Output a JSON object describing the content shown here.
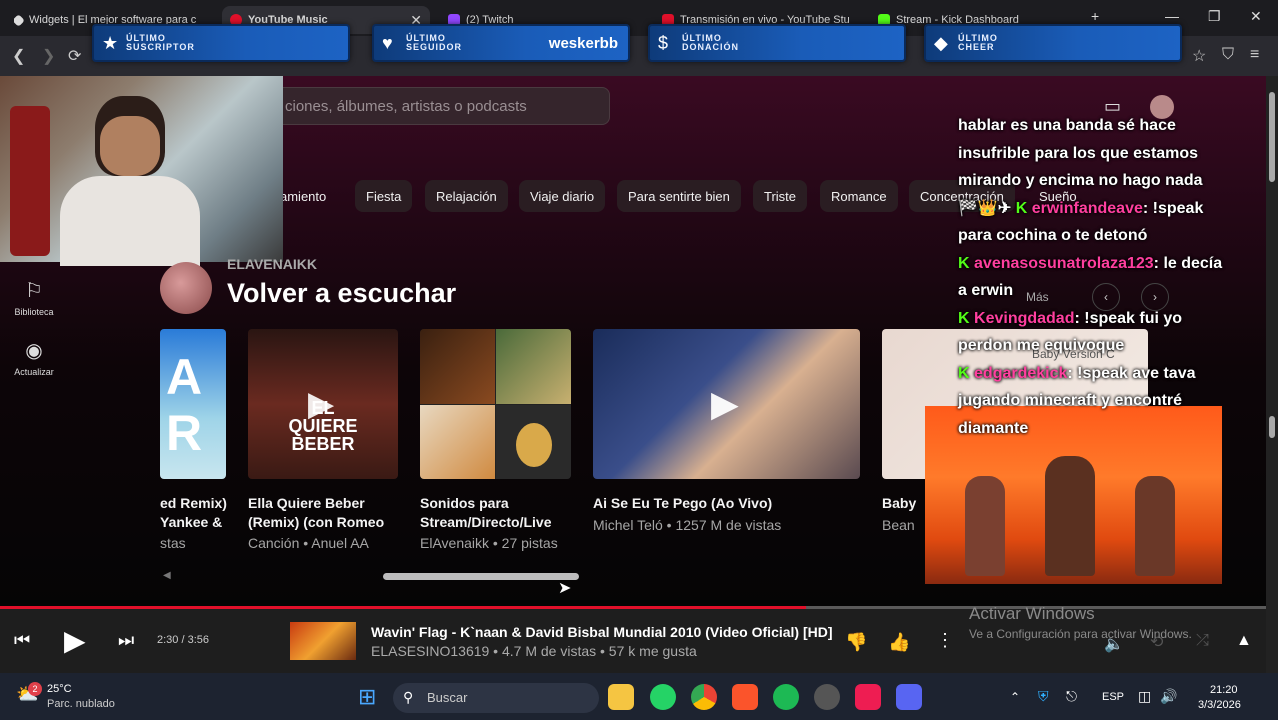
{
  "tabs": [
    {
      "label": "Widgets | El mejor software para c"
    },
    {
      "label": "YouTube Music"
    },
    {
      "label": "(2) Twitch"
    },
    {
      "label": "Transmisión en vivo - YouTube Stu"
    },
    {
      "label": "Stream - Kick Dashboard"
    }
  ],
  "overlays": {
    "sub": {
      "label": "ÚLTIMO SUSCRIPTOR",
      "value": ""
    },
    "follower": {
      "label": "ÚLTIMO SEGUIDOR",
      "value": "weskerbb"
    },
    "donation": {
      "label": "ÚLTIMO DONACIÓN",
      "value": ""
    },
    "cheer": {
      "label": "ÚLTIMO CHEER",
      "value": ""
    }
  },
  "search": {
    "placeholder": "ciones, álbumes, artistas o podcasts"
  },
  "chips": [
    "amiento",
    "Fiesta",
    "Relajación",
    "Viaje diario",
    "Para sentirte bien",
    "Triste",
    "Romance",
    "Concentración",
    "Sueño"
  ],
  "nav": {
    "library": "Biblioteca",
    "upgrade": "Actualizar"
  },
  "section": {
    "user": "ELAVENAIKK",
    "title": "Volver a escuchar"
  },
  "cards": [
    {
      "title": "ed Remix) Yankee &",
      "sub": "stas"
    },
    {
      "title": "Ella Quiere Beber (Remix) (con Romeo",
      "sub": "Canción • Anuel AA",
      "art": "EL QUIERE BEBER"
    },
    {
      "title": "Sonidos para Stream/Directo/Live",
      "sub": "ElAvenaikk • 27 pistas"
    },
    {
      "title": "Ai Se Eu Te Pego (Ao Vivo)",
      "sub": "Michel Teló • 1257 M de vistas"
    },
    {
      "title": "Baby",
      "sub": "Bean"
    }
  ],
  "chat": {
    "line0": "hablar es una banda sé hace insufrible para los que estamos mirando y encima no hago nada",
    "msgs": [
      {
        "user": "erwinfandeave",
        "text": ": !speak para cochina o te detonó"
      },
      {
        "user": "avenasosunatrolaza123",
        "text": ": le decía a erwin"
      },
      {
        "user": "Kevingdadad",
        "text": ": !speak fui yo perdon me equivoque"
      },
      {
        "user": "edgardekick",
        "text": ": !speak ave tava jugando minecraft y encontré diamante"
      }
    ],
    "more": "Más",
    "card5_overlay": "Baby Version C"
  },
  "player": {
    "time": "2:30 / 3:56",
    "progress": 0.637,
    "title": "Wavin' Flag - K`naan & David Bisbal Mundial 2010 (Video Oficial) [HD]",
    "meta": "ELASESINO13619 • 4.7 M de vistas • 57 k me gusta"
  },
  "activate": {
    "title": "Activar Windows",
    "sub": "Ve a Configuración para activar Windows."
  },
  "taskbar": {
    "weather_temp": "25°C",
    "weather_desc": "Parc. nublado",
    "badge": "2",
    "search": "Buscar",
    "lang": "ESP",
    "time": "21:20",
    "date": "3/3/2026"
  }
}
